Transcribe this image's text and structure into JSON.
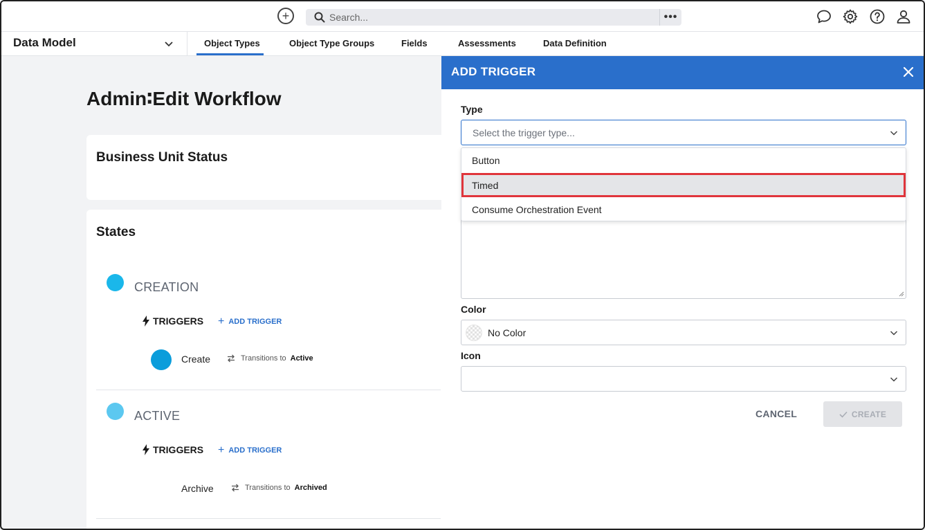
{
  "topbar": {
    "search_placeholder": "Search...",
    "icons": [
      "plus-circle-icon",
      "search-icon",
      "more-icon",
      "chat-icon",
      "gear-icon",
      "help-icon",
      "user-icon"
    ]
  },
  "nav": {
    "module": "Data Model",
    "tabs": [
      "Object Types",
      "Object Type Groups",
      "Fields",
      "Assessments",
      "Data Definition"
    ],
    "active_tab": "Object Types"
  },
  "page": {
    "title": "Admin∶Edit Workflow",
    "workflow_name": "Business Unit Status",
    "states_title": "States",
    "states": [
      {
        "name": "CREATION",
        "color": "#1ab7ea",
        "triggers_label": "TRIGGERS",
        "add_trigger_label": "ADD TRIGGER",
        "triggers": [
          {
            "name": "Create",
            "transitions_label": "Transitions to",
            "target": "Active",
            "color": "#0b9ddb"
          }
        ]
      },
      {
        "name": "ACTIVE",
        "color": "#5cc8f0",
        "triggers_label": "TRIGGERS",
        "add_trigger_label": "ADD TRIGGER",
        "triggers": [
          {
            "name": "Archive",
            "transitions_label": "Transitions to",
            "target": "Archived"
          }
        ]
      }
    ]
  },
  "panel": {
    "title": "ADD TRIGGER",
    "type_label": "Type",
    "type_placeholder": "Select the trigger type...",
    "type_options": [
      "Button",
      "Timed",
      "Consume Orchestration Event"
    ],
    "highlighted_option": "Timed",
    "color_label": "Color",
    "color_value": "No Color",
    "icon_label": "Icon",
    "icon_value": "",
    "cancel_label": "CANCEL",
    "create_label": "CREATE"
  },
  "colors": {
    "accent": "#2a6fcb",
    "highlight_border": "#e0353b"
  }
}
